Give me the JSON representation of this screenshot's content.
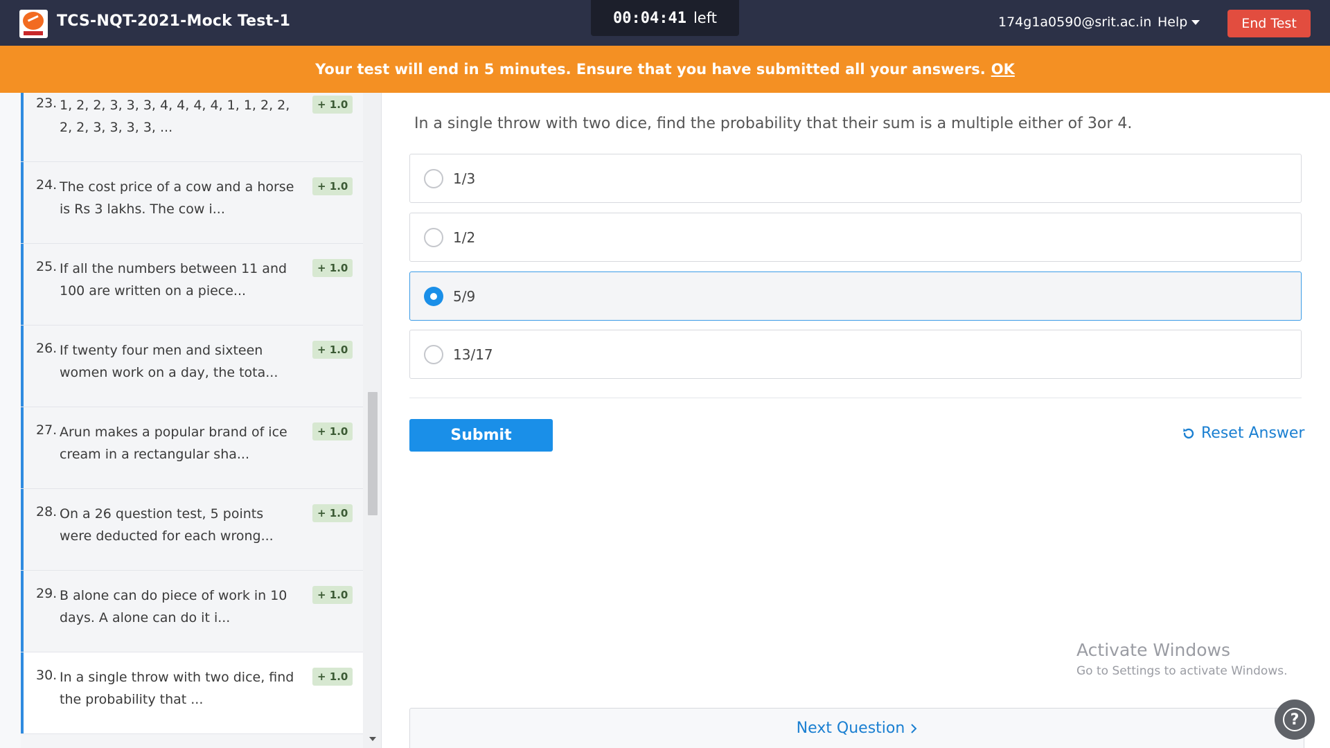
{
  "header": {
    "title": "TCS-NQT-2021-Mock Test-1",
    "timer": "00:04:41",
    "timer_suffix": "left",
    "email": "174g1a0590@srit.ac.in",
    "help_label": "Help",
    "end_label": "End Test"
  },
  "warning": {
    "message": "Your test will end in 5 minutes. Ensure that you have submitted all your answers.",
    "ok_label": "OK"
  },
  "sidebar": {
    "items": [
      {
        "num": "23.",
        "text": "1, 2, 2, 3, 3, 3, 4, 4, 4, 4, 1, 1, 2, 2, 2, 2, 3, 3, 3, 3, ...",
        "badge": "+ 1.0"
      },
      {
        "num": "24.",
        "text": "The cost price of a cow and a horse is Rs 3 lakhs. The cow i...",
        "badge": "+ 1.0"
      },
      {
        "num": "25.",
        "text": "If all the numbers between 11 and 100 are written on a piece...",
        "badge": "+ 1.0"
      },
      {
        "num": "26.",
        "text": "If twenty four men and sixteen women work on a day, the tota...",
        "badge": "+ 1.0"
      },
      {
        "num": "27.",
        "text": "Arun makes a popular brand of ice cream in a rectangular sha...",
        "badge": "+ 1.0"
      },
      {
        "num": "28.",
        "text": "On a 26 question test, 5 points were deducted for each wrong...",
        "badge": "+ 1.0"
      },
      {
        "num": "29.",
        "text": "B alone can do piece of work in 10 days. A alone can do it i...",
        "badge": "+ 1.0"
      },
      {
        "num": "30.",
        "text": " In a single throw with two dice, find the probability that ...",
        "badge": "+ 1.0"
      }
    ]
  },
  "question": {
    "text": "In a single throw with two dice, find the probability that their sum is a multiple either of 3or 4.",
    "options": [
      "1/3",
      "1/2",
      "5/9",
      "13/17"
    ],
    "selected_index": 2
  },
  "actions": {
    "submit_label": "Submit",
    "reset_label": "Reset Answer",
    "next_label": "Next Question"
  },
  "watermark": {
    "line1": "Activate Windows",
    "line2": "Go to Settings to activate Windows."
  },
  "icons": {
    "caret": "caret-down-icon",
    "reset": "reset-icon",
    "next": "chevron-right-icon",
    "help": "question-icon"
  },
  "colors": {
    "header_bg": "#2c3147",
    "warning_bg": "#f49023",
    "accent": "#1a8fe8",
    "end_button": "#e24d3f"
  }
}
